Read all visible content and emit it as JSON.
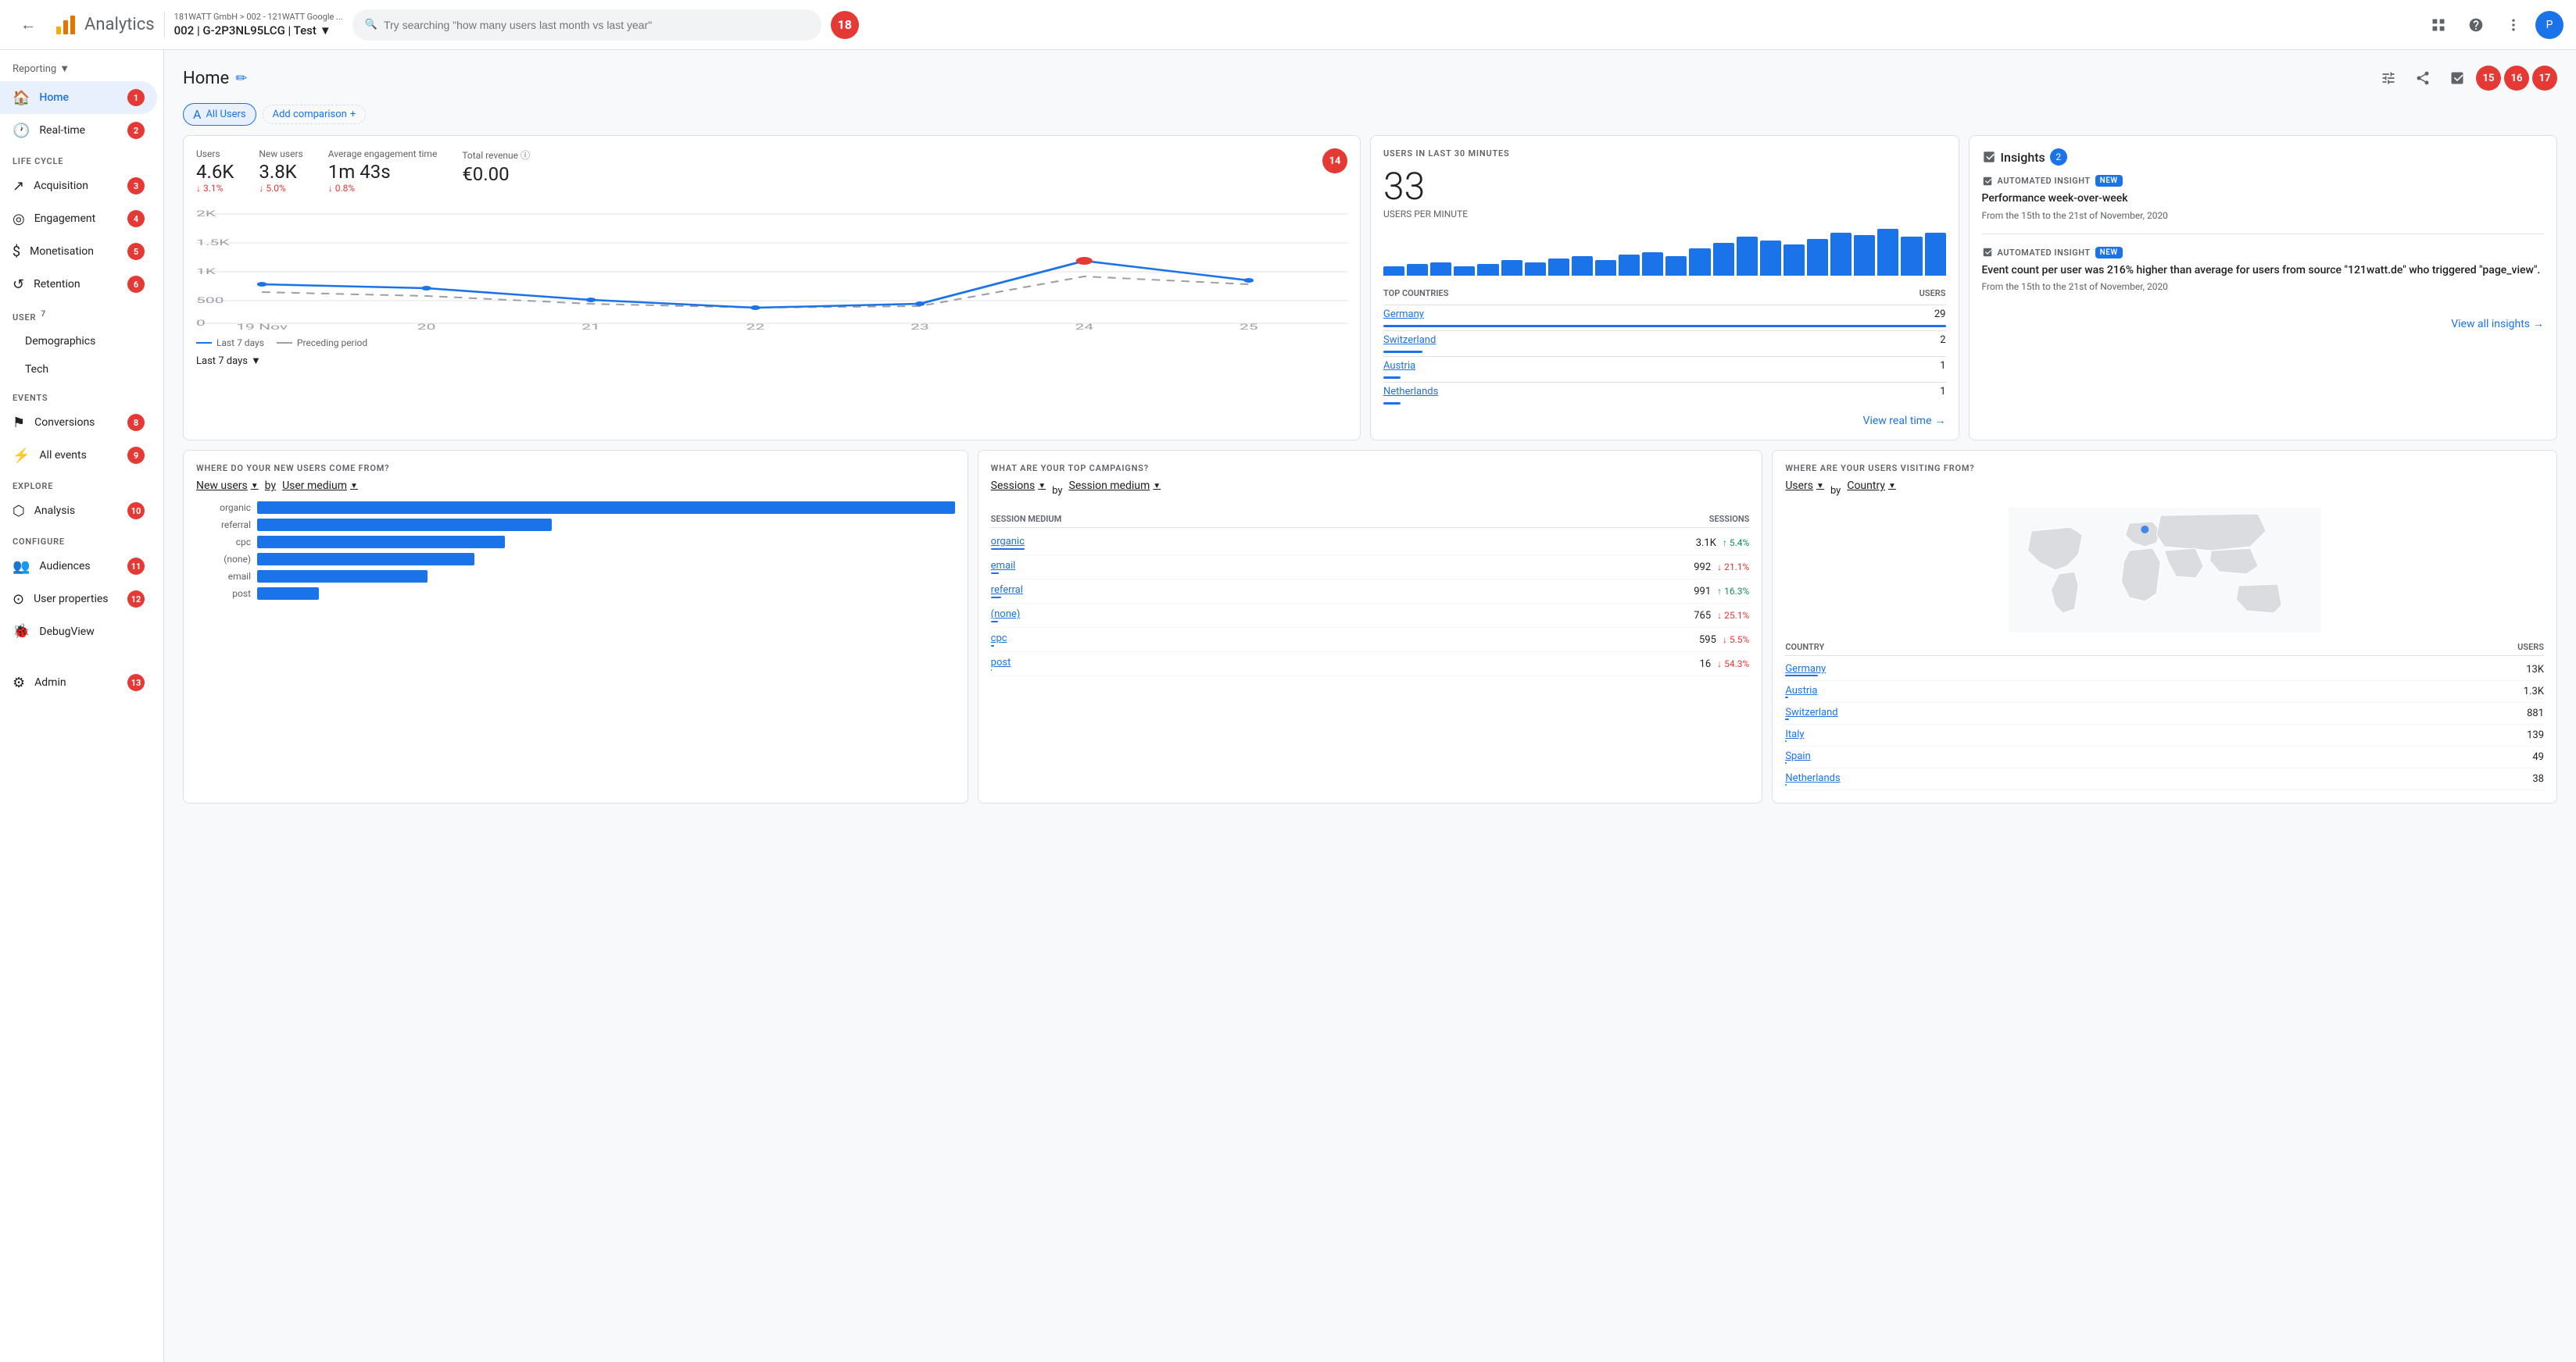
{
  "topbar": {
    "back_icon": "←",
    "app_name": "Analytics",
    "breadcrumb": "181WATT GmbH > 002 - 121WATT Google ...",
    "property": "002 | G-2P3NL95LCG | Test",
    "search_placeholder": "Try searching \"how many users last month vs last year\"",
    "badge_number": "18",
    "grid_icon": "⊞",
    "help_icon": "?",
    "more_icon": "⋮",
    "avatar_initial": "P"
  },
  "sidebar": {
    "reporting_label": "Reporting",
    "home_label": "Home",
    "home_badge": "1",
    "realtime_label": "Real-time",
    "realtime_badge": "2",
    "lifecycle_section": "LIFE CYCLE",
    "acquisition_label": "Acquisition",
    "acquisition_badge": "3",
    "engagement_label": "Engagement",
    "engagement_badge": "4",
    "monetisation_label": "Monetisation",
    "monetisation_badge": "5",
    "retention_label": "Retention",
    "retention_badge": "6",
    "user_section": "USER",
    "user_badge": "7",
    "demographics_label": "Demographics",
    "tech_label": "Tech",
    "events_section": "EVENTS",
    "conversions_label": "Conversions",
    "conversions_badge": "8",
    "allevents_label": "All events",
    "allevents_badge": "9",
    "explore_section": "EXPLORE",
    "analysis_label": "Analysis",
    "analysis_badge": "10",
    "configure_section": "CONFIGURE",
    "audiences_label": "Audiences",
    "audiences_badge": "11",
    "userprops_label": "User properties",
    "userprops_badge": "12",
    "debugview_label": "DebugView",
    "admin_label": "Admin",
    "admin_badge": "13"
  },
  "header": {
    "title": "Home",
    "badge15": "15",
    "badge16": "16",
    "badge17": "17"
  },
  "filters": {
    "all_users": "All Users",
    "add_comparison": "Add comparison"
  },
  "metrics": {
    "users_label": "Users",
    "users_value": "4.6K",
    "users_change": "↓ 3.1%",
    "new_users_label": "New users",
    "new_users_value": "3.8K",
    "new_users_change": "↓ 5.0%",
    "avg_eng_label": "Average engagement time",
    "avg_eng_value": "1m 43s",
    "avg_eng_change": "↓ 0.8%",
    "total_rev_label": "Total revenue ⓘ",
    "total_rev_value": "€0.00",
    "badge14": "14"
  },
  "chart": {
    "y_labels": [
      "2K",
      "1.5K",
      "1K",
      "500",
      "0"
    ],
    "x_labels": [
      "19\nNov",
      "20",
      "21",
      "22",
      "23",
      "24",
      "25"
    ],
    "legend_last7": "Last 7 days",
    "legend_preceding": "Preceding period",
    "period_label": "Last 7 days"
  },
  "realtime": {
    "title": "USERS IN LAST 30 MINUTES",
    "number": "33",
    "subtitle": "USERS PER MINUTE",
    "bars": [
      3,
      4,
      5,
      3,
      4,
      6,
      5,
      7,
      8,
      6,
      9,
      10,
      8,
      12,
      15,
      18,
      16,
      14,
      17,
      20,
      19,
      22,
      18,
      20
    ],
    "countries_header_left": "TOP COUNTRIES",
    "countries_header_right": "USERS",
    "countries": [
      {
        "name": "Germany",
        "users": "29",
        "bar_pct": 100
      },
      {
        "name": "Switzerland",
        "users": "2",
        "bar_pct": 7
      },
      {
        "name": "Austria",
        "users": "1",
        "bar_pct": 3
      },
      {
        "name": "Netherlands",
        "users": "1",
        "bar_pct": 3
      }
    ],
    "link": "View real time"
  },
  "insights": {
    "title": "Insights",
    "count": "2",
    "items": [
      {
        "chip": "AUTOMATED INSIGHT",
        "badge": "New",
        "title": "Performance week-over-week",
        "date": "From the 15th to the 21st of November, 2020"
      },
      {
        "chip": "AUTOMATED INSIGHT",
        "badge": "New",
        "title": "Event count per user was 216% higher than average for users from source \"121watt.de\" who triggered \"page_view\".",
        "date": "From the 15th to the 21st of November, 2020"
      }
    ],
    "link": "View all insights"
  },
  "new_users_section": {
    "question": "WHERE DO YOUR NEW USERS COME FROM?",
    "dropdown_left": "New users",
    "dropdown_right": "User medium",
    "bars": [
      {
        "label": "organic",
        "pct": 90
      },
      {
        "label": "referral",
        "pct": 38
      },
      {
        "label": "cpc",
        "pct": 32
      },
      {
        "label": "(none)",
        "pct": 28
      },
      {
        "label": "email",
        "pct": 22
      },
      {
        "label": "post",
        "pct": 8
      }
    ]
  },
  "campaigns_section": {
    "question": "WHAT ARE YOUR TOP CAMPAIGNS?",
    "dropdown_left": "Sessions",
    "dropdown_right": "Session medium",
    "header_left": "SESSION MEDIUM",
    "header_right": "SESSIONS",
    "rows": [
      {
        "medium": "organic",
        "value": "3.1K",
        "change": "↑ 5.4%",
        "direction": "up",
        "bar_pct": 100
      },
      {
        "medium": "email",
        "value": "992",
        "change": "↓ 21.1%",
        "direction": "down",
        "bar_pct": 32
      },
      {
        "medium": "referral",
        "value": "991",
        "change": "↑ 16.3%",
        "direction": "up",
        "bar_pct": 32
      },
      {
        "medium": "(none)",
        "value": "765",
        "change": "↓ 25.1%",
        "direction": "down",
        "bar_pct": 25
      },
      {
        "medium": "cpc",
        "value": "595",
        "change": "↓ 5.5%",
        "direction": "down",
        "bar_pct": 19
      },
      {
        "medium": "post",
        "value": "16",
        "change": "↓ 54.3%",
        "direction": "down",
        "bar_pct": 1
      }
    ]
  },
  "geo_section": {
    "question": "WHERE ARE YOUR USERS VISITING FROM?",
    "dropdown_left": "Users",
    "dropdown_right": "Country",
    "header_left": "COUNTRY",
    "header_right": "USERS",
    "rows": [
      {
        "country": "Germany",
        "value": "13K",
        "bar_pct": 100
      },
      {
        "country": "Austria",
        "value": "1.3K",
        "bar_pct": 10
      },
      {
        "country": "Switzerland",
        "value": "881",
        "bar_pct": 7
      },
      {
        "country": "Italy",
        "value": "139",
        "bar_pct": 1
      },
      {
        "country": "Spain",
        "value": "49",
        "bar_pct": 0.4
      },
      {
        "country": "Netherlands",
        "value": "38",
        "bar_pct": 0.3
      }
    ]
  }
}
